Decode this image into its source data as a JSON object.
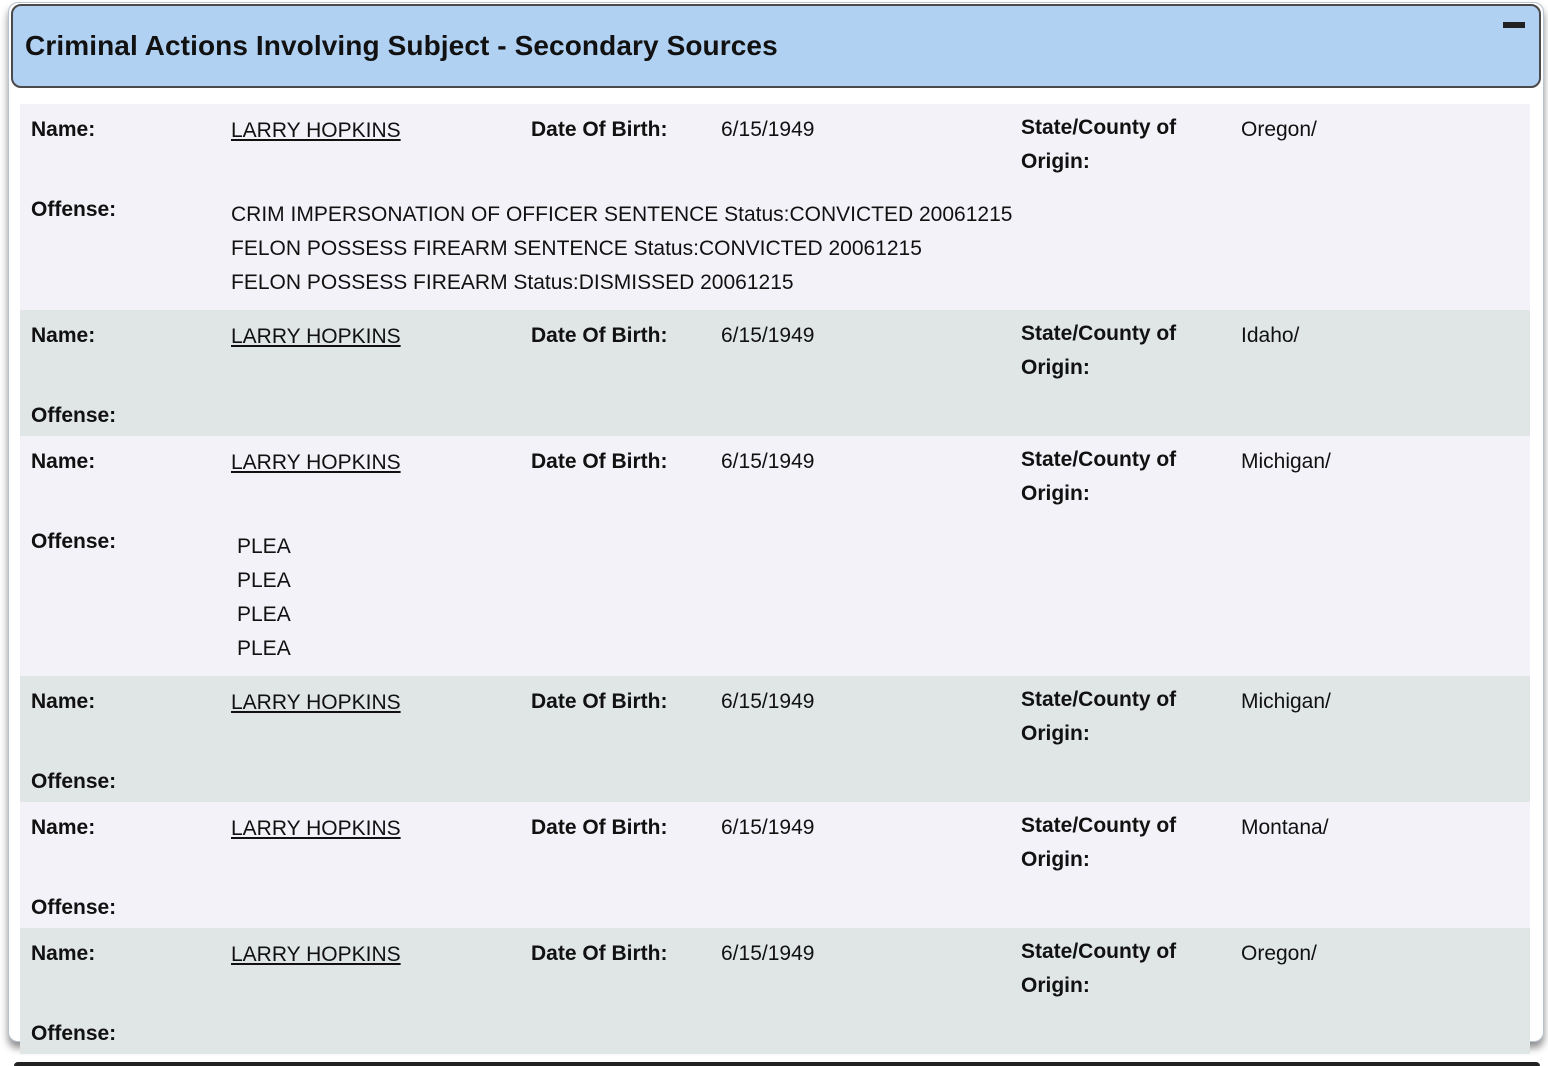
{
  "panel": {
    "title": "Criminal Actions Involving Subject - Secondary Sources"
  },
  "labels": {
    "name": "Name:",
    "dob": "Date Of Birth:",
    "origin": "State/County of Origin:",
    "offense": "Offense:"
  },
  "records": [
    {
      "name": "LARRY HOPKINS",
      "dob": "6/15/1949",
      "origin": "Oregon/",
      "offenses": [
        "CRIM IMPERSONATION OF OFFICER SENTENCE Status:CONVICTED 20061215",
        "FELON POSSESS FIREARM SENTENCE Status:CONVICTED 20061215",
        "FELON POSSESS FIREARM Status:DISMISSED 20061215"
      ]
    },
    {
      "name": "LARRY HOPKINS",
      "dob": "6/15/1949",
      "origin": "Idaho/",
      "offenses": []
    },
    {
      "name": "LARRY HOPKINS",
      "dob": "6/15/1949",
      "origin": "Michigan/",
      "offenses": [
        "PLEA",
        "PLEA",
        "PLEA",
        "PLEA"
      ]
    },
    {
      "name": "LARRY HOPKINS",
      "dob": "6/15/1949",
      "origin": "Michigan/",
      "offenses": []
    },
    {
      "name": "LARRY HOPKINS",
      "dob": "6/15/1949",
      "origin": "Montana/",
      "offenses": []
    },
    {
      "name": "LARRY HOPKINS",
      "dob": "6/15/1949",
      "origin": "Oregon/",
      "offenses": []
    }
  ]
}
